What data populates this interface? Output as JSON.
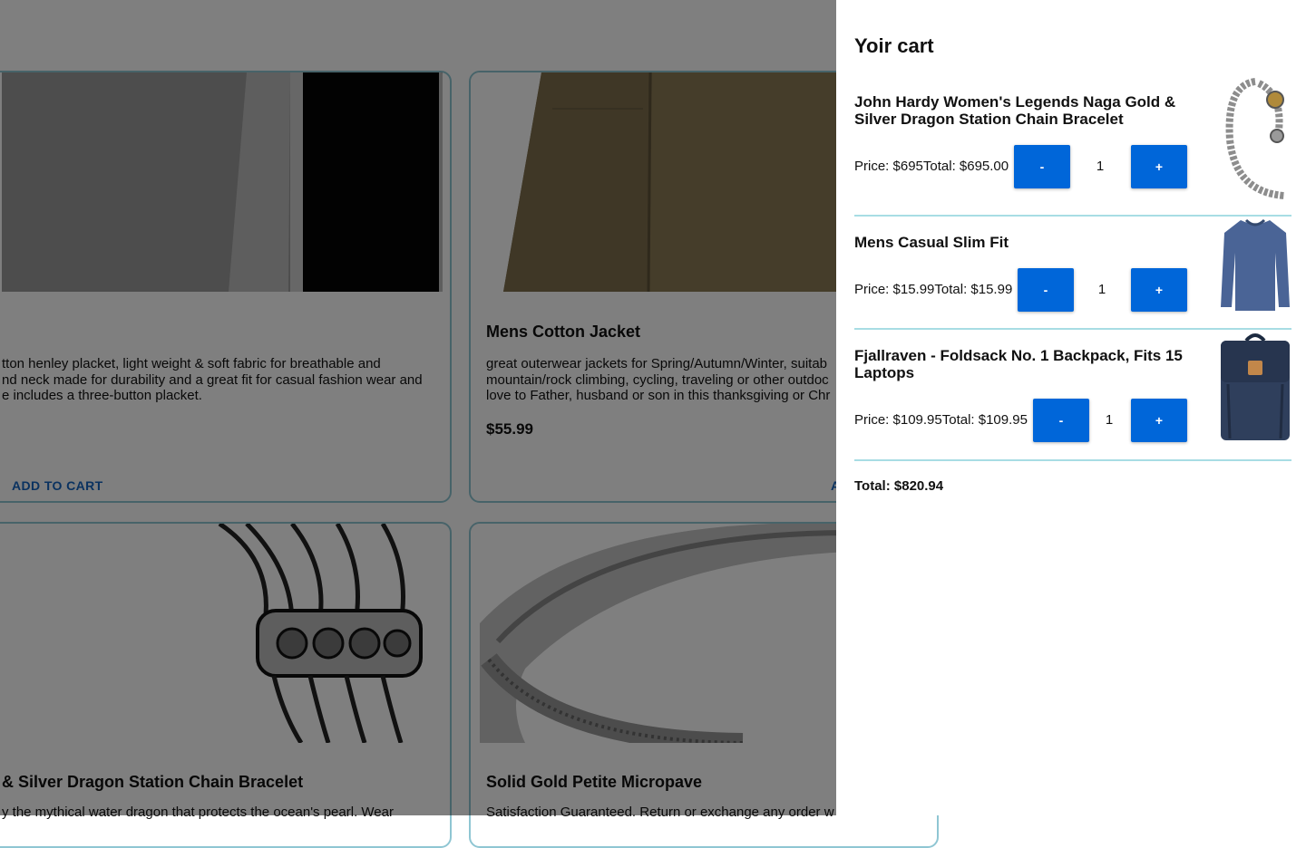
{
  "products": [
    {
      "title": "",
      "description": "tton henley placket, light weight & soft fabric for breathable and\nnd neck made for durability and a great fit for casual fashion wear and\ne includes a three-button placket.",
      "price": "",
      "button": "ADD TO CART"
    },
    {
      "title": "Mens Cotton Jacket",
      "description": "great outerwear jackets for Spring/Autumn/Winter, suitab\nmountain/rock climbing, cycling, traveling or other outdoc\nlove to Father, husband or son in this thanksgiving or Chr",
      "price": "$55.99",
      "button": "A"
    },
    {
      "title": "& Silver Dragon Station Chain Bracelet",
      "description": "y the mythical water dragon that protects the ocean's pearl. Wear",
      "price": "",
      "button": ""
    },
    {
      "title": "Solid Gold Petite Micropave",
      "description": "Satisfaction Guaranteed. Return or exchange any order w",
      "price": "",
      "button": ""
    }
  ],
  "cart": {
    "title": "Yoir cart",
    "items": [
      {
        "title": "John Hardy Women's Legends Naga Gold & Silver Dragon Station Chain Bracelet",
        "price_line": "Price: $695Total: $695.00",
        "minus": "-",
        "qty": "1",
        "plus": "+",
        "thumb": "bracelet-image"
      },
      {
        "title": "Mens Casual Slim Fit",
        "price_line": "Price: $15.99Total: $15.99",
        "minus": "-",
        "qty": "1",
        "plus": "+",
        "thumb": "shirt-image"
      },
      {
        "title": "Fjallraven - Foldsack No. 1 Backpack, Fits 15 Laptops",
        "price_line": "Price: $109.95Total: $109.95",
        "minus": "-",
        "qty": "1",
        "plus": "+",
        "thumb": "backpack-image"
      }
    ],
    "grand_total": "Total: $820.94"
  },
  "colors": {
    "accent_button": "#0066d9",
    "link_button": "#1565c0",
    "card_border": "#8fc6d3",
    "divider": "#a8dde4"
  }
}
